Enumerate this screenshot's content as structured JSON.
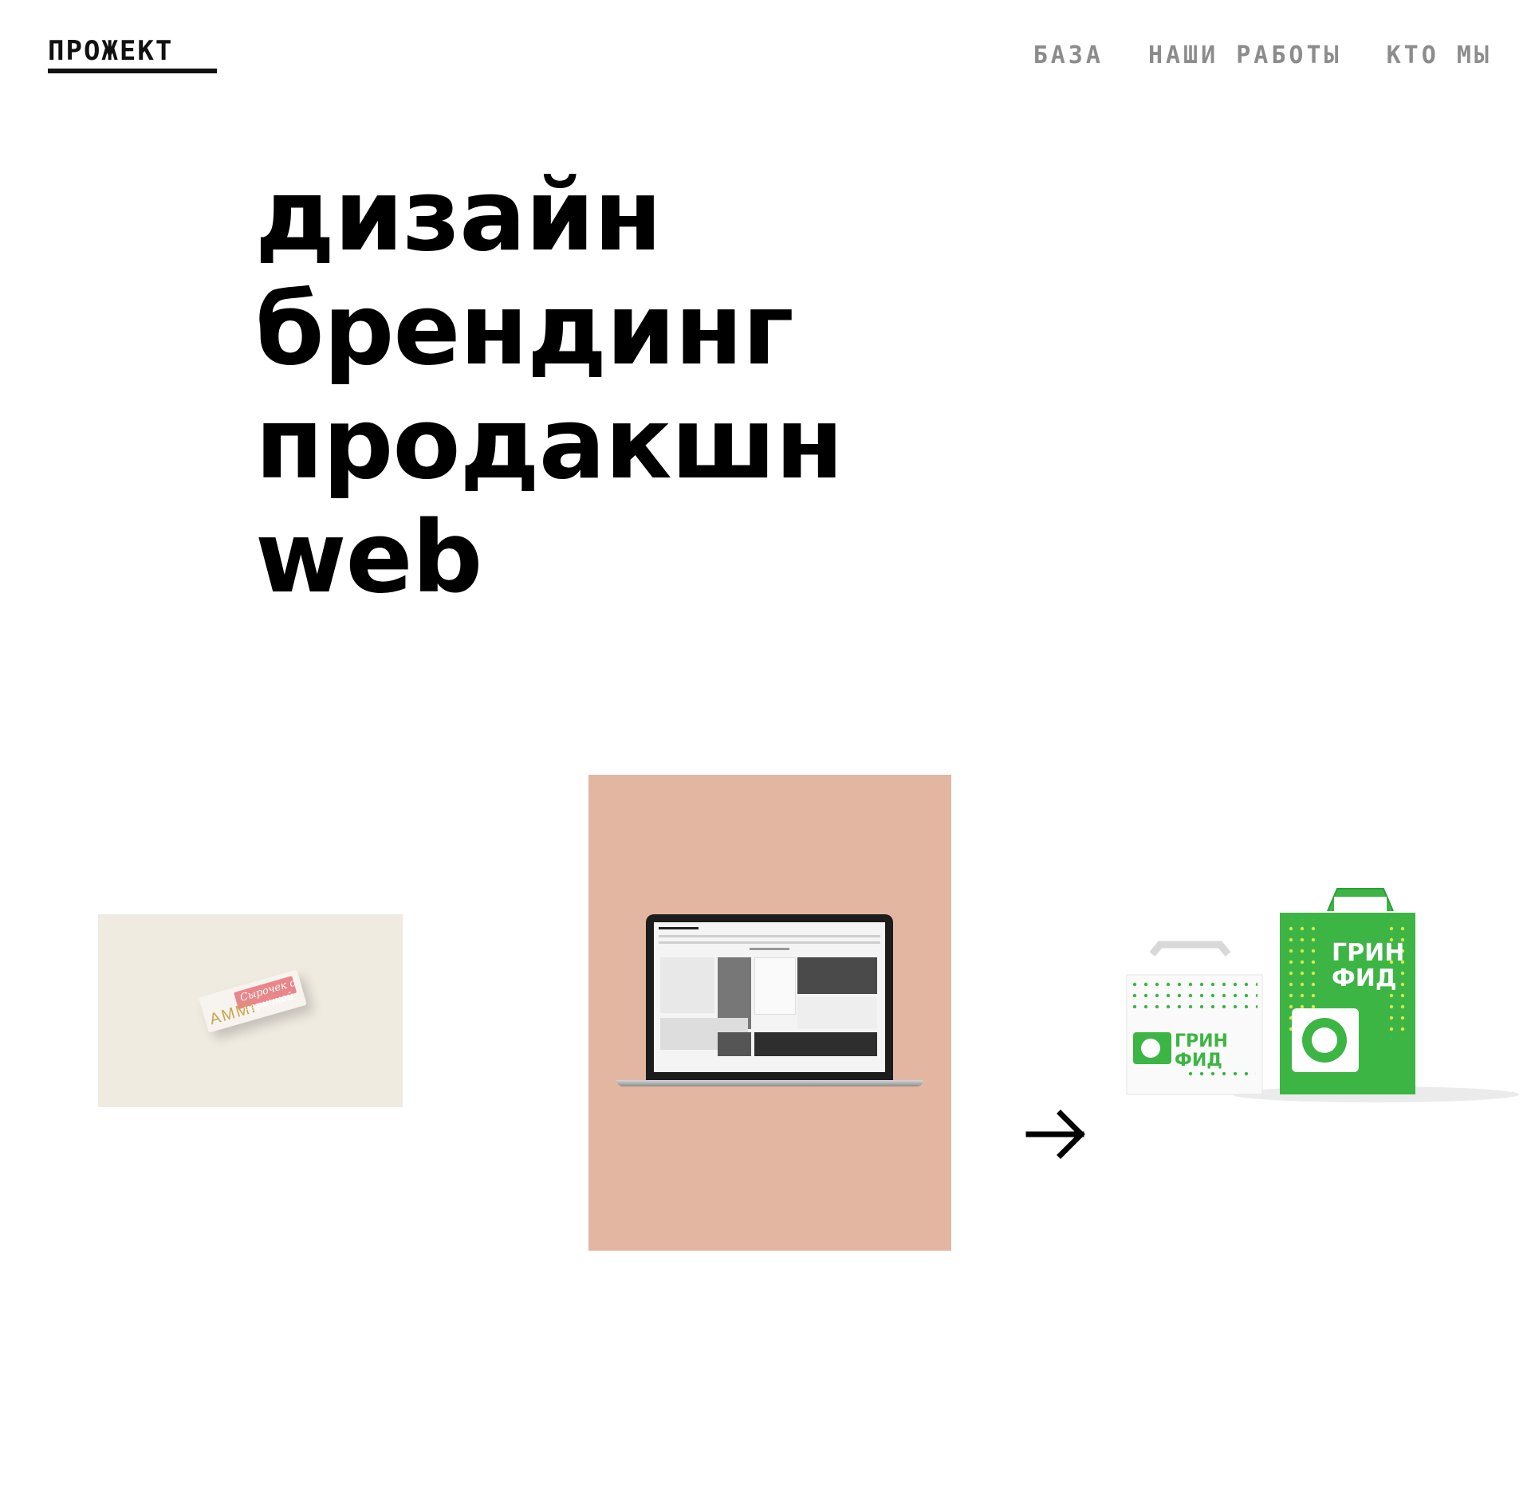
{
  "header": {
    "logo": "ПРОЖЕКТ",
    "nav": [
      {
        "label": "БАЗА"
      },
      {
        "label": "НАШИ РАБОТЫ"
      },
      {
        "label": "КТО МЫ"
      }
    ]
  },
  "hero": {
    "lines": [
      "дизайн",
      "брендинг",
      "продакшн",
      "web"
    ]
  },
  "gallery": {
    "ammi": {
      "brand": "AMMI",
      "script": "Сырочек с черникой"
    },
    "bags": {
      "brand_line1": "ГРИН",
      "brand_line2": "ФИД"
    },
    "next_icon": "arrow-right-icon"
  },
  "colors": {
    "nav_gray": "#8c8c8c",
    "laptop_bg": "#e2b6a1",
    "ammi_bg": "#efebe1",
    "bag_green": "#3cb544"
  }
}
